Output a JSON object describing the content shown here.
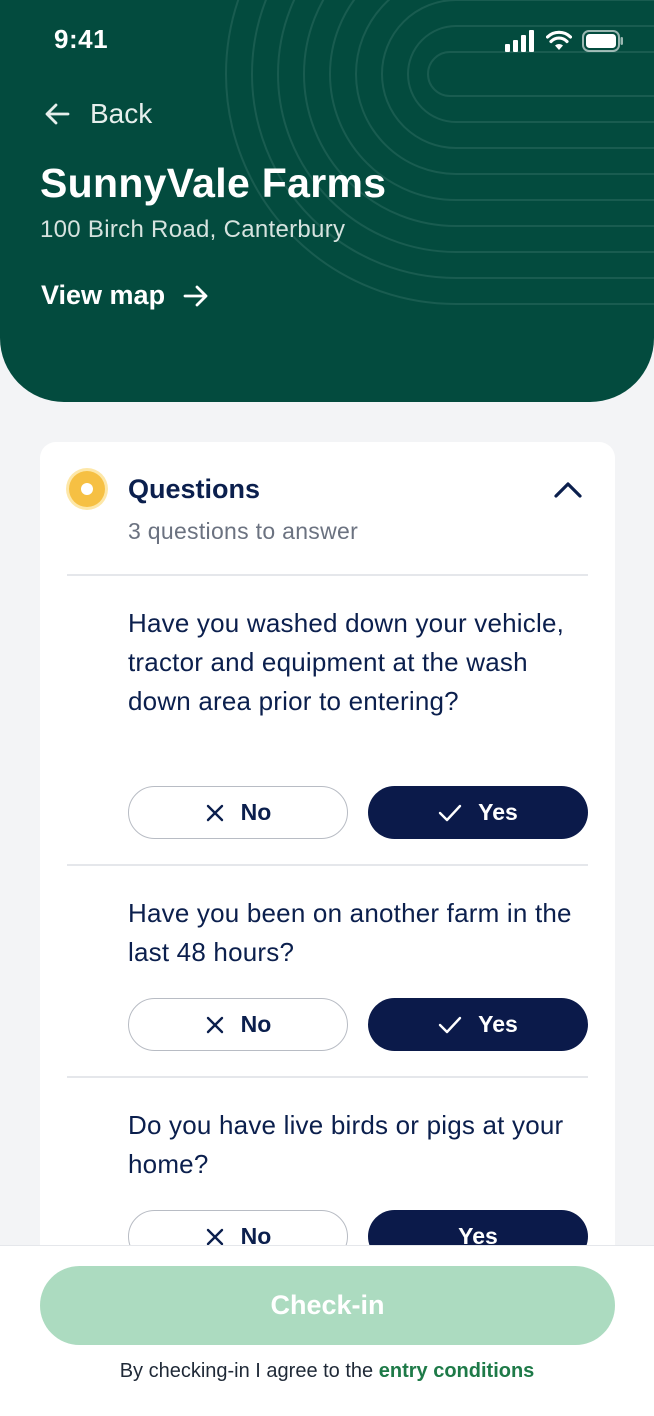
{
  "status_bar": {
    "time": "9:41"
  },
  "header": {
    "back_label": "Back",
    "title": "SunnyVale Farms",
    "address": "100 Birch Road, Canterbury",
    "view_map_label": "View map"
  },
  "questions_section": {
    "title": "Questions",
    "subtitle": "3 questions to answer",
    "status_color": "#f6c043",
    "items": [
      {
        "text": "Have you washed down your vehicle, tractor and equipment at the wash down area prior to entering?",
        "no_label": "No",
        "yes_label": "Yes",
        "selected": "Yes"
      },
      {
        "text": "Have you been on another farm in the last 48 hours?",
        "no_label": "No",
        "yes_label": "Yes",
        "selected": "Yes"
      },
      {
        "text": "Do you have live birds or pigs at your home?",
        "no_label": "No",
        "yes_label": "Yes",
        "selected": ""
      }
    ]
  },
  "footer": {
    "checkin_label": "Check-in",
    "agree_text": "By checking-in I agree to the ",
    "agree_link": "entry conditions"
  },
  "colors": {
    "header_bg": "#034b3e",
    "primary_navy": "#0b1a4a",
    "checkin_disabled": "#acdbc0",
    "link_green": "#1e7a48"
  }
}
